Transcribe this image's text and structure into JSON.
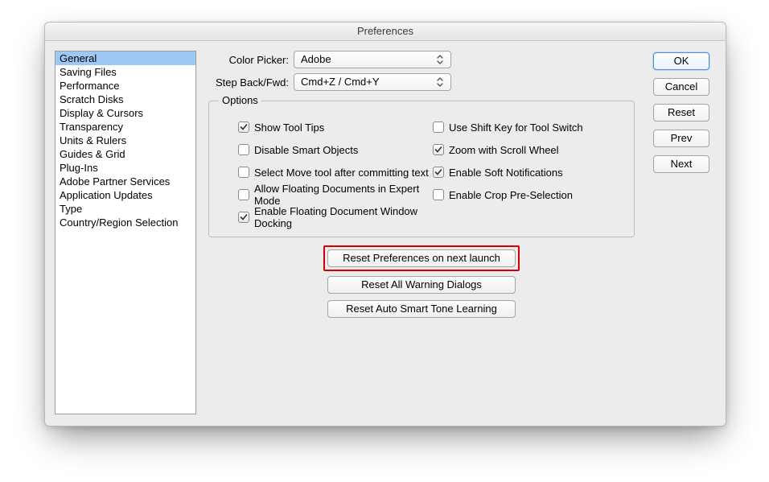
{
  "window": {
    "title": "Preferences"
  },
  "sidebar": {
    "items": [
      "General",
      "Saving Files",
      "Performance",
      "Scratch Disks",
      "Display & Cursors",
      "Transparency",
      "Units & Rulers",
      "Guides & Grid",
      "Plug-Ins",
      "Adobe Partner Services",
      "Application Updates",
      "Type",
      "Country/Region Selection"
    ],
    "selected_index": 0
  },
  "pickers": {
    "color_picker": {
      "label": "Color Picker:",
      "value": "Adobe"
    },
    "step_back": {
      "label": "Step Back/Fwd:",
      "value": "Cmd+Z / Cmd+Y"
    }
  },
  "options_box": {
    "legend": "Options",
    "left": [
      {
        "label": "Show Tool Tips",
        "checked": true
      },
      {
        "label": "Disable Smart Objects",
        "checked": false
      },
      {
        "label": "Select Move tool after committing text",
        "checked": false
      },
      {
        "label": "Allow Floating Documents in Expert Mode",
        "checked": false
      },
      {
        "label": "Enable Floating Document Window Docking",
        "checked": true
      }
    ],
    "right": [
      {
        "label": "Use Shift Key for Tool Switch",
        "checked": false
      },
      {
        "label": "Zoom with Scroll Wheel",
        "checked": true
      },
      {
        "label": "Enable Soft Notifications",
        "checked": true
      },
      {
        "label": "Enable Crop Pre-Selection",
        "checked": false
      }
    ]
  },
  "reset_buttons": {
    "b1": "Reset Preferences on next launch",
    "b2": "Reset All Warning Dialogs",
    "b3": "Reset Auto Smart Tone Learning"
  },
  "side_buttons": {
    "ok": "OK",
    "cancel": "Cancel",
    "reset": "Reset",
    "prev": "Prev",
    "next": "Next"
  }
}
